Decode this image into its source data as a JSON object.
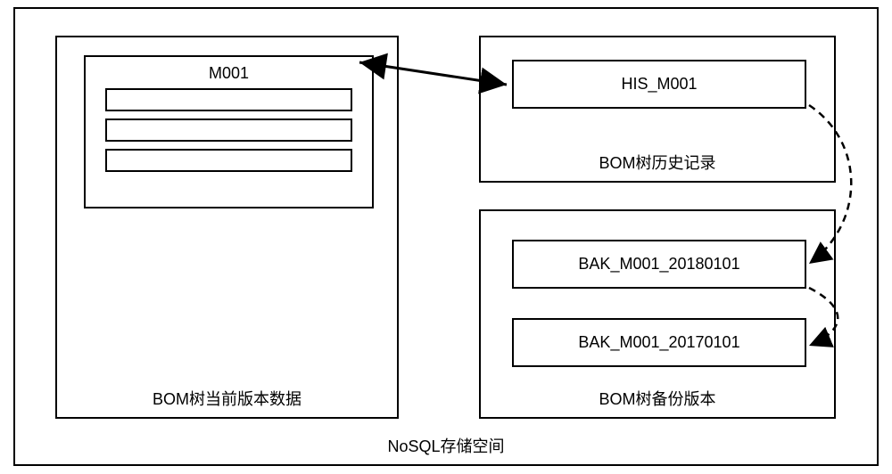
{
  "diagram": {
    "outer_label": "NoSQL存储空间",
    "left_panel": {
      "label": "BOM树当前版本数据",
      "box_title": "M001"
    },
    "right_top_panel": {
      "label": "BOM树历史记录",
      "his_label": "HIS_M001"
    },
    "right_bottom_panel": {
      "label": "BOM树备份版本",
      "bak1_label": "BAK_M001_20180101",
      "bak2_label": "BAK_M001_20170101"
    }
  }
}
